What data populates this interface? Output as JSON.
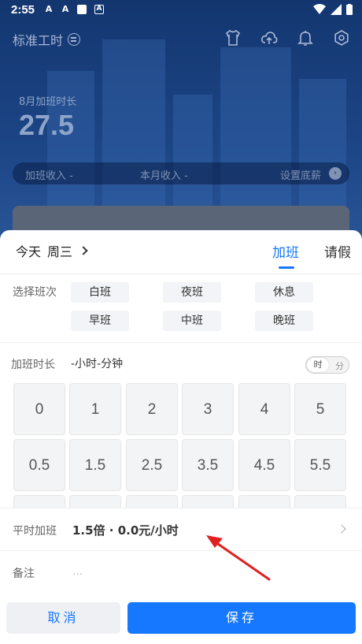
{
  "status_bar": {
    "time": "2:55",
    "icon_a1": "A",
    "icon_a2": "A",
    "icon_a3": "A"
  },
  "app": {
    "title": "标准工时"
  },
  "summary": {
    "month_label": "8月加班时长",
    "month_value": "27.5",
    "overtime_income": "加班收入 -",
    "monthly_income": "本月收入 -",
    "set_base_salary": "设置底薪"
  },
  "sheet": {
    "date": "今天",
    "weekday": "周三",
    "tabs": {
      "overtime": "加班",
      "leave": "请假"
    },
    "shift_label": "选择班次",
    "shifts": [
      "白班",
      "夜班",
      "休息",
      "早班",
      "中班",
      "晚班"
    ],
    "duration_label": "加班时长",
    "duration_value": "-小时-分钟",
    "unit_toggle": {
      "hour": "时",
      "minute": "分"
    },
    "keys": [
      "0",
      "1",
      "2",
      "3",
      "4",
      "5",
      "0.5",
      "1.5",
      "2.5",
      "3.5",
      "4.5",
      "5.5"
    ],
    "rate_label": "平时加班",
    "rate_value": "1.5倍 · 0.0元/小时",
    "note_label": "备注",
    "note_placeholder": "...",
    "cancel": "取消",
    "save": "保存"
  },
  "colors": {
    "accent": "#1677ff",
    "header_bg": "#1d4687",
    "annotation": "#e02020"
  }
}
